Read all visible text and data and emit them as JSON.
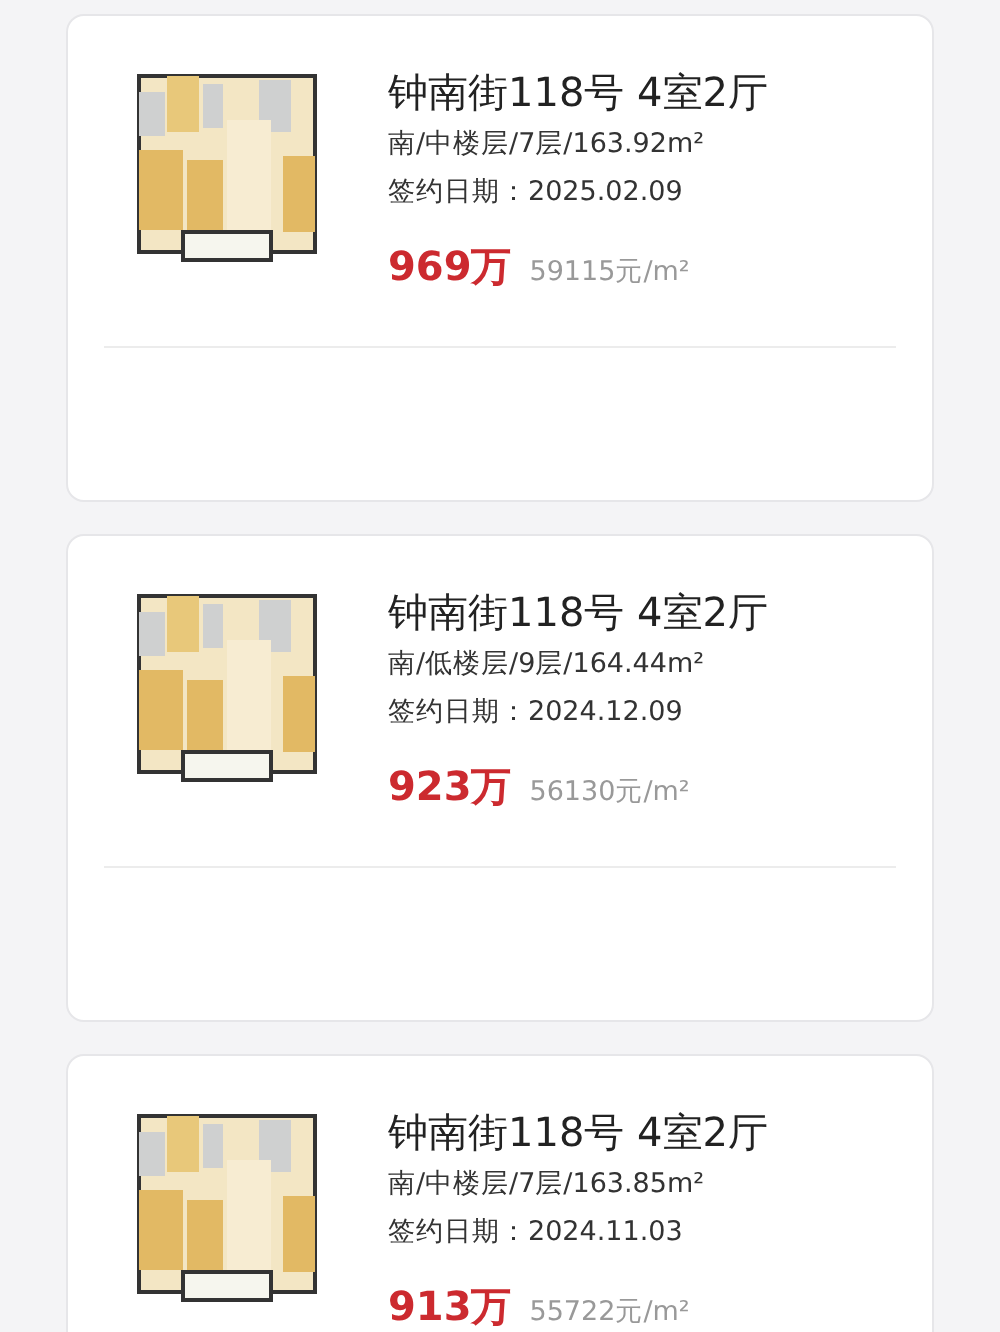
{
  "listings": [
    {
      "title": "钟南街118号 4室2厅",
      "details": "南/中楼层/7层/163.92m²",
      "date": "签约日期：2025.02.09",
      "price": "969万",
      "unit_price": "59115元/m²"
    },
    {
      "title": "钟南街118号 4室2厅",
      "details": "南/低楼层/9层/164.44m²",
      "date": "签约日期：2024.12.09",
      "price": "923万",
      "unit_price": "56130元/m²"
    },
    {
      "title": "钟南街118号 4室2厅",
      "details": "南/中楼层/7层/163.85m²",
      "date": "签约日期：2024.11.03",
      "price": "913万",
      "unit_price": "55722元/m²"
    }
  ]
}
